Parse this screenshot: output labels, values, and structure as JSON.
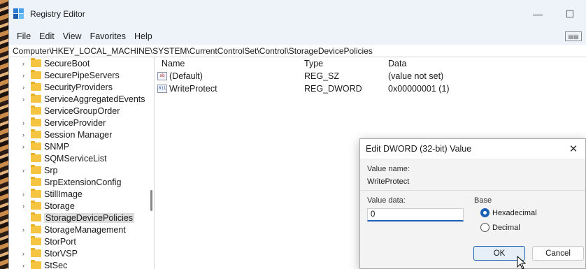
{
  "window": {
    "title": "Registry Editor",
    "minimize": "—",
    "maximize": "☐"
  },
  "menu": [
    "File",
    "Edit",
    "View",
    "Favorites",
    "Help"
  ],
  "address": "Computer\\HKEY_LOCAL_MACHINE\\SYSTEM\\CurrentControlSet\\Control\\StorageDevicePolicies",
  "tree": [
    {
      "label": "SecureBoot",
      "expandable": true
    },
    {
      "label": "SecurePipeServers",
      "expandable": true
    },
    {
      "label": "SecurityProviders",
      "expandable": true
    },
    {
      "label": "ServiceAggregatedEvents",
      "expandable": true
    },
    {
      "label": "ServiceGroupOrder",
      "expandable": false
    },
    {
      "label": "ServiceProvider",
      "expandable": true
    },
    {
      "label": "Session Manager",
      "expandable": true
    },
    {
      "label": "SNMP",
      "expandable": true
    },
    {
      "label": "SQMServiceList",
      "expandable": false
    },
    {
      "label": "Srp",
      "expandable": true
    },
    {
      "label": "SrpExtensionConfig",
      "expandable": false
    },
    {
      "label": "StillImage",
      "expandable": true
    },
    {
      "label": "Storage",
      "expandable": true
    },
    {
      "label": "StorageDevicePolicies",
      "expandable": false,
      "selected": true
    },
    {
      "label": "StorageManagement",
      "expandable": true
    },
    {
      "label": "StorPort",
      "expandable": false
    },
    {
      "label": "StorVSP",
      "expandable": true
    },
    {
      "label": "StSec",
      "expandable": true
    }
  ],
  "list": {
    "headers": {
      "name": "Name",
      "type": "Type",
      "data": "Data"
    },
    "rows": [
      {
        "icon": "string-value-icon",
        "glyph": "ab",
        "name": "(Default)",
        "type": "REG_SZ",
        "data": "(value not set)"
      },
      {
        "icon": "binary-value-icon",
        "glyph": "011",
        "name": "WriteProtect",
        "type": "REG_DWORD",
        "data": "0x00000001 (1)"
      }
    ]
  },
  "dialog": {
    "title": "Edit DWORD (32-bit) Value",
    "value_name_label": "Value name:",
    "value_name": "WriteProtect",
    "value_data_label": "Value data:",
    "value_data": "0",
    "base_label": "Base",
    "radio_hex": "Hexadecimal",
    "radio_dec": "Decimal",
    "ok": "OK",
    "cancel": "Cancel"
  }
}
